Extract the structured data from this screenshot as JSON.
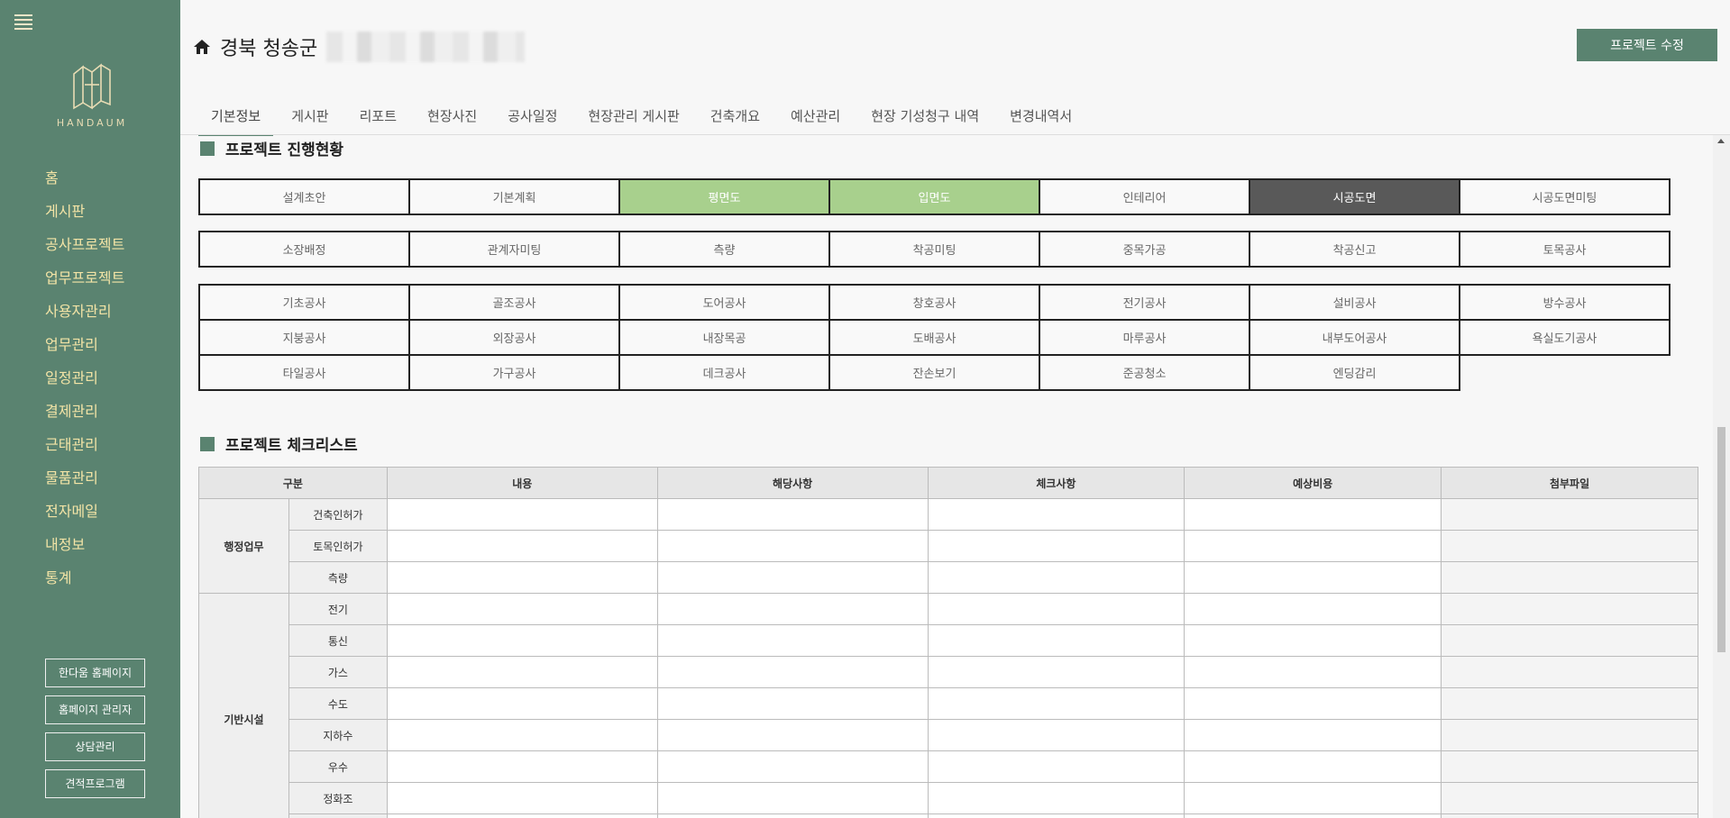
{
  "sidebar": {
    "logo_text": "HANDAUM",
    "nav": [
      "홈",
      "게시판",
      "공사프로젝트",
      "업무프로젝트",
      "사용자관리",
      "업무관리",
      "일정관리",
      "결제관리",
      "근태관리",
      "물품관리",
      "전자메일",
      "내정보",
      "통계"
    ],
    "buttons": [
      "한다움 홈페이지",
      "홈페이지 관리자",
      "상담관리",
      "견적프로그램"
    ]
  },
  "header": {
    "title": "경북 청송군",
    "edit_button": "프로젝트 수정",
    "tabs": [
      "기본정보",
      "게시판",
      "리포트",
      "현장사진",
      "공사일정",
      "현장관리 게시판",
      "건축개요",
      "예산관리",
      "현장 기성청구 내역",
      "변경내역서"
    ],
    "active_tab": 0
  },
  "progress": {
    "title": "프로젝트 진행현황",
    "group1": [
      {
        "label": "설계초안",
        "state": "normal"
      },
      {
        "label": "기본계획",
        "state": "normal"
      },
      {
        "label": "평면도",
        "state": "done"
      },
      {
        "label": "입면도",
        "state": "done"
      },
      {
        "label": "인테리어",
        "state": "normal"
      },
      {
        "label": "시공도면",
        "state": "current"
      },
      {
        "label": "시공도면미팅",
        "state": "normal"
      }
    ],
    "group2": [
      {
        "label": "소장배정",
        "state": "normal"
      },
      {
        "label": "관계자미팅",
        "state": "normal"
      },
      {
        "label": "측량",
        "state": "normal"
      },
      {
        "label": "착공미팅",
        "state": "normal"
      },
      {
        "label": "중목가공",
        "state": "normal"
      },
      {
        "label": "착공신고",
        "state": "normal"
      },
      {
        "label": "토목공사",
        "state": "normal"
      }
    ],
    "group3": [
      {
        "label": "기초공사",
        "state": "normal"
      },
      {
        "label": "골조공사",
        "state": "normal"
      },
      {
        "label": "도어공사",
        "state": "normal"
      },
      {
        "label": "창호공사",
        "state": "normal"
      },
      {
        "label": "전기공사",
        "state": "normal"
      },
      {
        "label": "설비공사",
        "state": "normal"
      },
      {
        "label": "방수공사",
        "state": "normal"
      },
      {
        "label": "지붕공사",
        "state": "normal"
      },
      {
        "label": "외장공사",
        "state": "normal"
      },
      {
        "label": "내장목공",
        "state": "normal"
      },
      {
        "label": "도배공사",
        "state": "normal"
      },
      {
        "label": "마루공사",
        "state": "normal"
      },
      {
        "label": "내부도어공사",
        "state": "normal"
      },
      {
        "label": "욕실도기공사",
        "state": "normal"
      },
      {
        "label": "타일공사",
        "state": "normal"
      },
      {
        "label": "가구공사",
        "state": "normal"
      },
      {
        "label": "데크공사",
        "state": "normal"
      },
      {
        "label": "잔손보기",
        "state": "normal"
      },
      {
        "label": "준공청소",
        "state": "normal"
      },
      {
        "label": "엔딩감리",
        "state": "normal"
      }
    ]
  },
  "checklist": {
    "title": "프로젝트 체크리스트",
    "headers": [
      "구분",
      "내용",
      "해당사항",
      "체크사항",
      "예상비용",
      "첨부파일"
    ],
    "groups": [
      {
        "name": "행정업무",
        "rows": [
          "건축인허가",
          "토목인허가",
          "측량"
        ]
      },
      {
        "name": "기반시설",
        "rows": [
          "전기",
          "통신",
          "가스",
          "수도",
          "지하수",
          "우수",
          "정화조",
          ""
        ]
      }
    ]
  },
  "colors": {
    "sidebar_bg": "#5a8370",
    "nav_text": "#f3e4a6",
    "done_green": "#a8d08d",
    "current_dark": "#595959"
  }
}
